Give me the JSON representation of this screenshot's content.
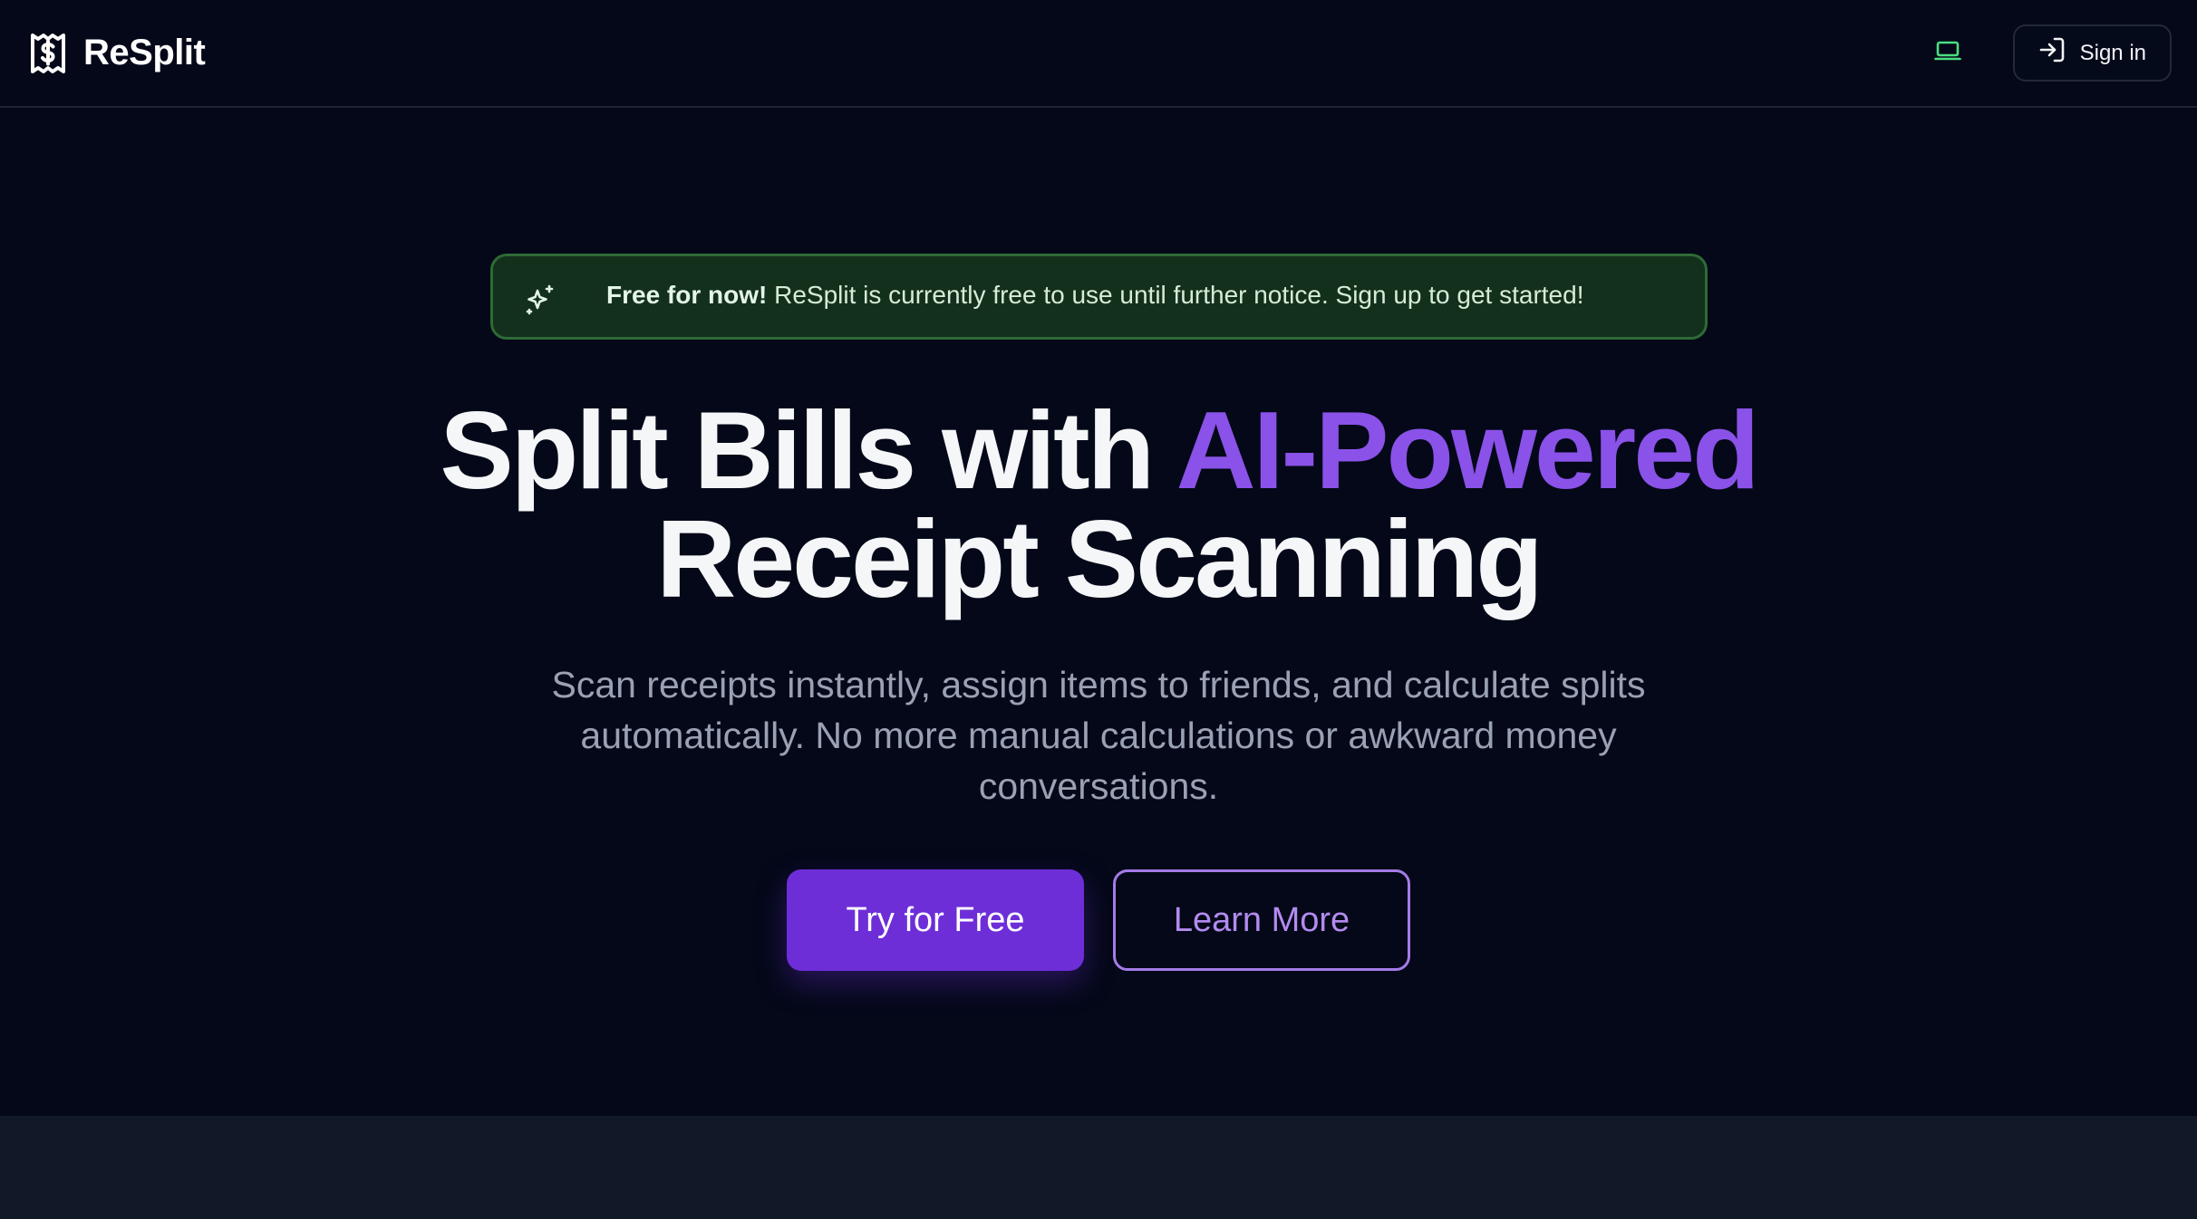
{
  "header": {
    "brand_name": "ReSplit",
    "brand_icon": "receipt-dollar-icon",
    "theme_icon": "laptop-icon",
    "signin_icon": "log-in-icon",
    "signin_label": "Sign in"
  },
  "banner": {
    "icon": "sparkles-icon",
    "bold": "Free for now!",
    "text": " ReSplit is currently free to use until further notice. Sign up to get started!"
  },
  "hero": {
    "title_part1": "Split Bills with ",
    "title_accent": "AI-Powered",
    "title_part2": "Receipt Scanning",
    "subtitle_line1": "Scan receipts instantly, assign items to friends, and calculate splits",
    "subtitle_line2": "automatically. No more manual calculations or awkward money",
    "subtitle_line3": "conversations.",
    "primary_cta": "Try for Free",
    "secondary_cta": "Learn More"
  },
  "colors": {
    "background": "#040818",
    "accent": "#8a52e8",
    "primary_button": "#6d2ed8",
    "banner_bg": "#13301d",
    "banner_border": "#2e6a36",
    "theme_icon": "#4ade80"
  }
}
